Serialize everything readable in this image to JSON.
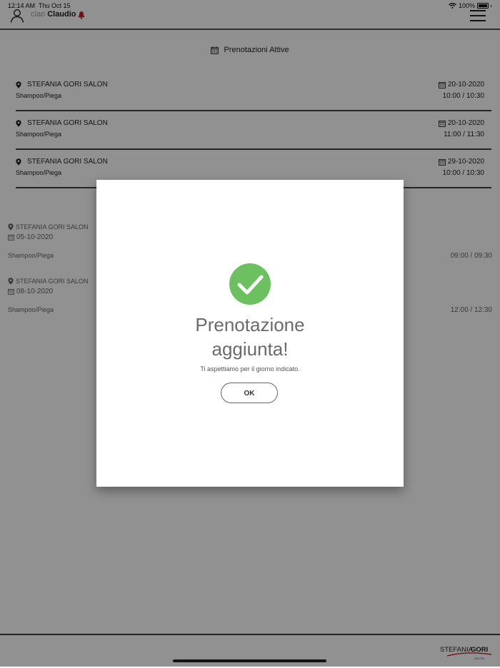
{
  "status_bar": {
    "time": "12:14 AM",
    "date": "Thu Oct 15",
    "battery": "100%"
  },
  "header": {
    "greeting": "ciao",
    "user_name": "Claudio"
  },
  "active_section": {
    "title": "Prenotazioni Attive"
  },
  "active_bookings": [
    {
      "salon": "STEFANIA GORI SALON",
      "service": "Shampoo/Piega",
      "date": "20-10-2020",
      "slot": "10:00 / 10:30"
    },
    {
      "salon": "STEFANIA GORI SALON",
      "service": "Shampoo/Piega",
      "date": "20-10-2020",
      "slot": "11:00 / 11:30"
    },
    {
      "salon": "STEFANIA GORI SALON",
      "service": "Shampoo/Piega",
      "date": "29-10-2020",
      "slot": "10:00 / 10:30"
    }
  ],
  "past_bookings": [
    {
      "salon": "STEFANIA GORI SALON",
      "date": "05-10-2020",
      "service": "Shampoo/Piega",
      "slot": "09:00 / 09:30"
    },
    {
      "salon": "STEFANIA GORI SALON",
      "date": "08-10-2020",
      "service": "Shampoo/Piega",
      "slot": "12:00 / 12:30"
    }
  ],
  "footer": {
    "logo_text_1": "STEFANIA",
    "logo_text_2": "GORI",
    "logo_sub": "SALON"
  },
  "modal": {
    "title_line1": "Prenotazione",
    "title_line2": "aggiunta!",
    "message": "Ti aspettiamo per il giorno indicato.",
    "ok_label": "OK"
  },
  "colors": {
    "success": "#6cc060",
    "accent_red": "#c0202a",
    "overlay": "rgba(0,0,0,0.43)"
  },
  "icons": {
    "user": "user-icon",
    "bell": "bell-icon",
    "menu": "hamburger-menu-icon",
    "pin": "location-pin-icon",
    "calendar": "calendar-icon",
    "check": "checkmark-circle-icon",
    "wifi": "wifi-icon",
    "battery": "battery-icon"
  }
}
